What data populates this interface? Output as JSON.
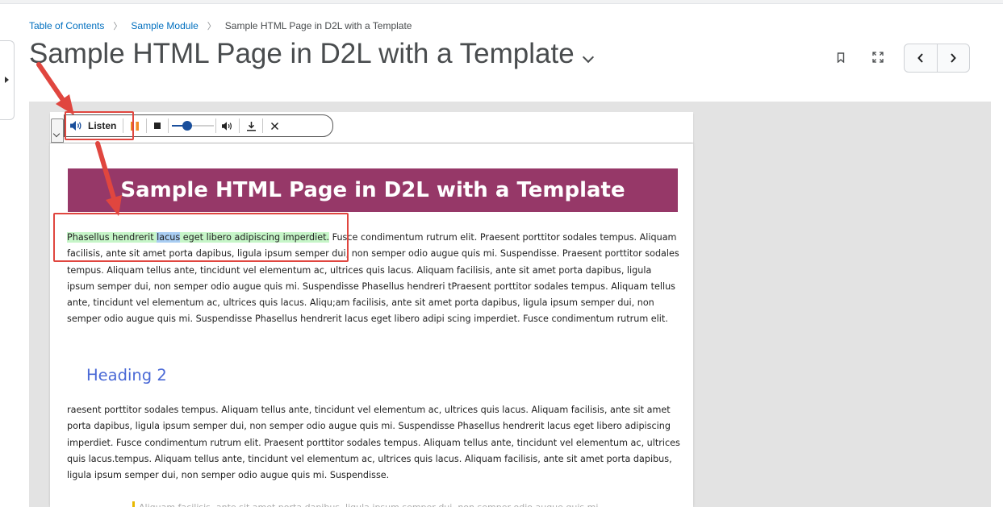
{
  "breadcrumb": {
    "items": [
      {
        "label": "Table of Contents"
      },
      {
        "label": "Sample Module"
      },
      {
        "label": "Sample HTML Page in D2L with a Template"
      }
    ]
  },
  "header": {
    "title": "Sample HTML Page in D2L with a Template"
  },
  "readspeaker": {
    "listen_label": "Listen",
    "volume_level": 0.35
  },
  "document": {
    "banner_title": "Sample HTML Page in D2L with a Template",
    "para1": {
      "highlight_before": "Phasellus hendrerit ",
      "highlight_word": "lacus",
      "highlight_after": " eget libero adipiscing imperdiet.",
      "rest": " Fusce condimentum rutrum elit. Praesent porttitor sodales tempus. Aliquam facilisis, ante sit amet porta dapibus, ligula ipsum semper dui, non semper odio augue quis mi. Suspendisse. Praesent porttitor sodales tempus. Aliquam tellus ante, tincidunt vel elementum ac, ultrices quis lacus. Aliquam facilisis, ante sit amet porta dapibus, ligula ipsum semper dui, non semper odio augue quis mi. Suspendisse Phasellus hendreri tPraesent porttitor sodales tempus. Aliquam tellus ante, tincidunt vel elementum ac, ultrices quis lacus. Aliqu;am facilisis, ante sit amet porta dapibus, ligula ipsum semper dui, non semper odio augue quis mi. Suspendisse Phasellus hendrerit lacus eget libero adipi scing imperdiet. Fusce condimentum rutrum elit."
    },
    "heading2": "Heading 2",
    "para2": "raesent porttitor sodales tempus. Aliquam tellus ante, tincidunt vel elementum ac, ultrices quis lacus. Aliquam facilisis, ante sit amet porta dapibus, ligula ipsum semper dui, non semper odio augue quis mi. Suspendisse Phasellus hendrerit lacus eget libero adipiscing imperdiet. Fusce condimentum rutrum elit. Praesent porttitor sodales tempus. Aliquam tellus ante, tincidunt vel elementum ac, ultrices quis lacus.tempus. Aliquam tellus ante, tincidunt vel elementum ac, ultrices quis lacus. Aliquam facilisis, ante sit amet porta dapibus, ligula ipsum semper dui, non semper odio augue quis mi. Suspendisse.",
    "blockquote_partial": "Aliquam facilisis, ante sit amet porta dapibus, ligula ipsum semper dui, non semper odio augue quis mi."
  },
  "colors": {
    "link": "#006fbf",
    "banner": "#963868",
    "heading2": "#4a69d6",
    "annotation": "#e0463f",
    "sentence_highlight": "#c6f5c8",
    "word_highlight": "#a9cdf2",
    "readspeaker_blue": "#1a4f9c",
    "pause_orange": "#f08a24"
  },
  "icons": {
    "bookmark": "bookmark-icon",
    "fullscreen": "fullscreen-icon",
    "previous": "chevron-left-icon",
    "next": "chevron-right-icon",
    "listen": "speaker-icon",
    "pause": "pause-icon",
    "stop": "stop-icon",
    "volume": "volume-icon",
    "download": "download-icon",
    "close": "close-icon"
  }
}
